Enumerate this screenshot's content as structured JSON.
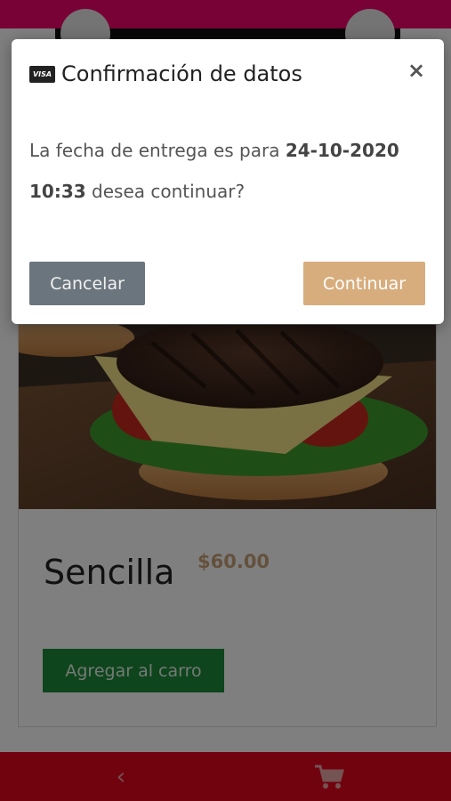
{
  "modal": {
    "title": "Confirmación de datos",
    "close_symbol": "×",
    "message_prefix": "La fecha de entrega es para ",
    "message_date": "24-10-2020 10:33",
    "message_suffix": " desea continuar?",
    "cancel_label": "Cancelar",
    "continue_label": "Continuar",
    "title_icon": "visa-card-icon",
    "visa_text": "VISA"
  },
  "product": {
    "name": "Sencilla",
    "price": "$60.00",
    "add_to_cart_label": "Agregar al carro"
  },
  "nav": {
    "back_icon": "chevron-left-icon",
    "back_symbol": "‹",
    "cart_icon": "shopping-cart-icon"
  },
  "colors": {
    "top_bar": "#f0056b",
    "bottom_bar": "#e2061f",
    "continue_button": "#d8ad7d",
    "cancel_button": "#6a757d",
    "add_to_cart_button": "#1c8a3a",
    "price": "#c8a27a"
  }
}
